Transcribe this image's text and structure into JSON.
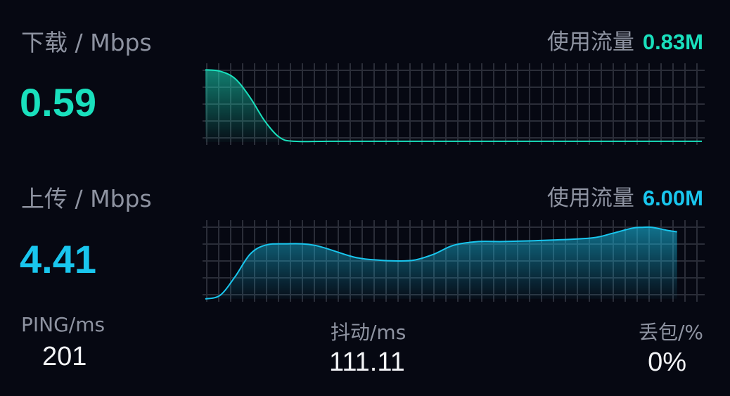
{
  "download": {
    "label": "下载 / Mbps",
    "value": "0.59",
    "usage_label": "使用流量",
    "usage_value": "0.83M",
    "color": "#19e0bd"
  },
  "upload": {
    "label": "上传 / Mbps",
    "value": "4.41",
    "usage_label": "使用流量",
    "usage_value": "6.00M",
    "color": "#19c6ee"
  },
  "stats": {
    "ping_label": "PING/ms",
    "ping_value": "201",
    "jitter_label": "抖动/ms",
    "jitter_value": "111.11",
    "loss_label": "丢包/%",
    "loss_value": "0%"
  },
  "chart_data": [
    {
      "type": "area",
      "series": [
        {
          "x": [
            0,
            0.03,
            0.06,
            0.09,
            0.12,
            0.15,
            0.18,
            0.25,
            0.4,
            0.6,
            0.8,
            1.0
          ],
          "values": [
            0.97,
            0.95,
            0.85,
            0.6,
            0.28,
            0.06,
            0.01,
            0.01,
            0.01,
            0.01,
            0.01,
            0.01
          ]
        }
      ],
      "ylim": [
        0,
        1
      ],
      "grid": true,
      "legend": "none"
    },
    {
      "type": "area",
      "series": [
        {
          "x": [
            0,
            0.03,
            0.06,
            0.09,
            0.12,
            0.16,
            0.22,
            0.3,
            0.35,
            0.38,
            0.42,
            0.46,
            0.5,
            0.55,
            0.6,
            0.7,
            0.78,
            0.82,
            0.86,
            0.88,
            0.9,
            0.93,
            0.95
          ],
          "values": [
            0.0,
            0.05,
            0.3,
            0.6,
            0.72,
            0.74,
            0.72,
            0.56,
            0.52,
            0.51,
            0.52,
            0.6,
            0.72,
            0.77,
            0.77,
            0.79,
            0.82,
            0.88,
            0.95,
            0.96,
            0.96,
            0.92,
            0.9
          ]
        }
      ],
      "ylim": [
        0,
        1
      ],
      "grid": true,
      "legend": "none"
    }
  ]
}
